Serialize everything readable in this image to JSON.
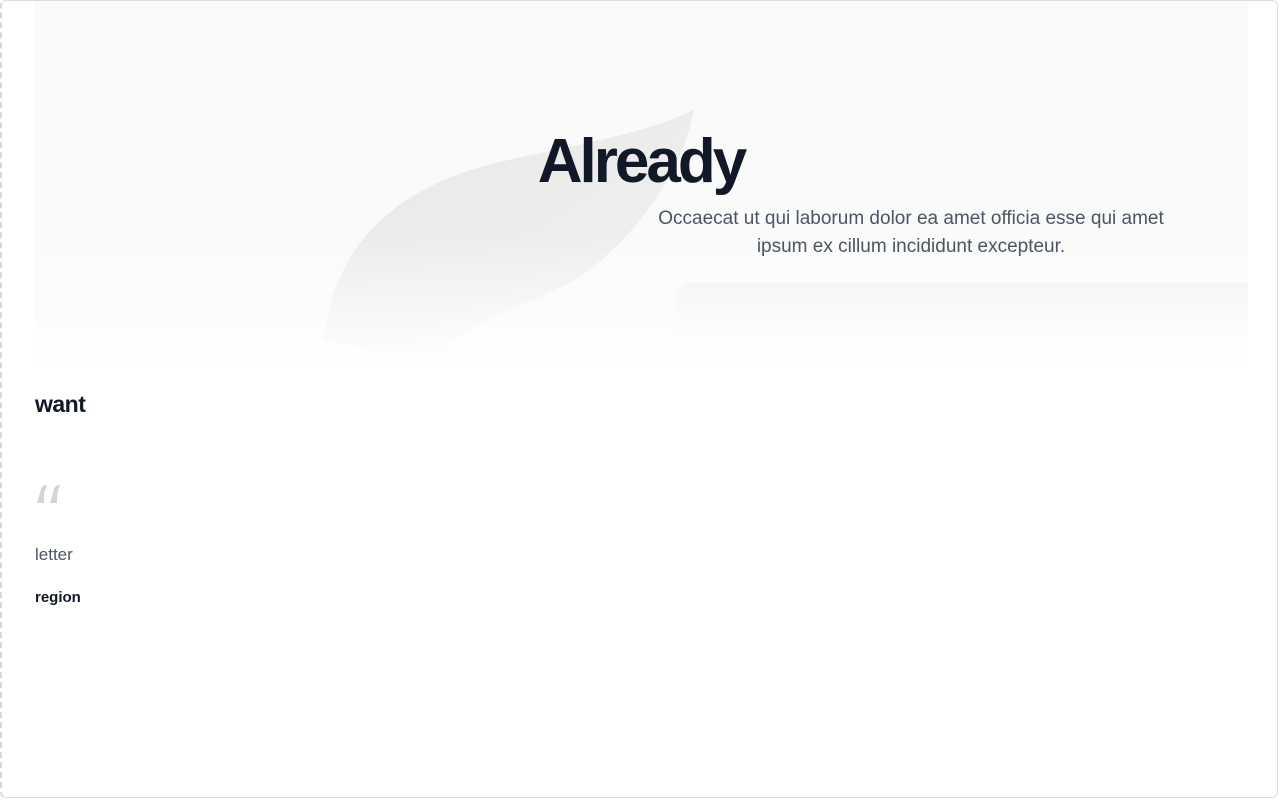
{
  "hero": {
    "title": "Already",
    "subtitle": "Occaecat ut qui laborum dolor ea amet officia esse qui amet ipsum ex cillum incididunt excepteur."
  },
  "testimonial": {
    "heading": "want",
    "quote": "letter",
    "author": "region",
    "icon": "quote-icon"
  },
  "colors": {
    "heading": "#111827",
    "body": "#4b5563",
    "quote_mark": "#d1d5db"
  }
}
